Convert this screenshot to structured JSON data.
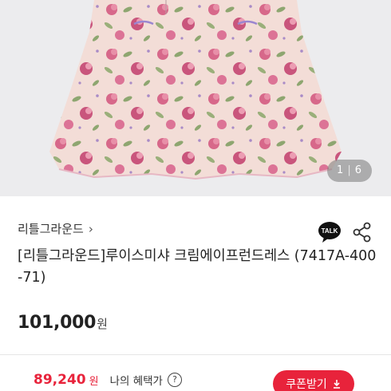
{
  "gallery": {
    "current": "1",
    "total": "6",
    "separator": "|",
    "image_name": "floral-dress-photo"
  },
  "product": {
    "brand": "리틀그라운드",
    "brand_chevron": "›",
    "title": "[리틀그라운드]루이스미샤 크림에이프런드레스 (7417A-400-71)",
    "price": "101,000",
    "price_unit": "원"
  },
  "actions": {
    "talk_label": "TALK"
  },
  "sale": {
    "price": "89,240",
    "unit": "원",
    "benefit_label": "나의 혜택가",
    "help_label": "?",
    "coupon_label": "쿠폰받기",
    "coupon_icon": "download-icon"
  },
  "colors": {
    "accent": "#e8233b",
    "talk_bubble": "#111111",
    "hero_bg": "#ececee"
  }
}
